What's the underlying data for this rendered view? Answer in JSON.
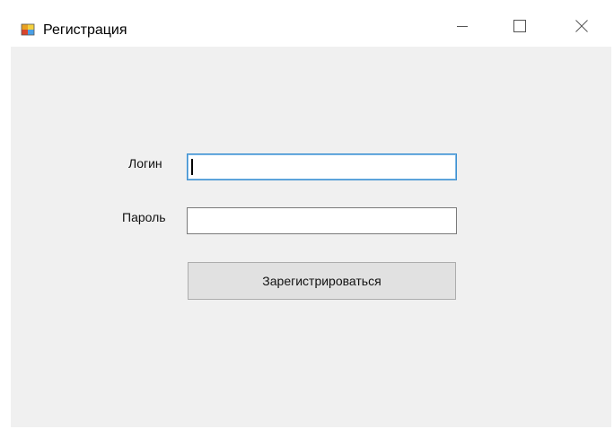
{
  "window": {
    "title": "Регистрация",
    "icon": "windows-form-app-icon",
    "controls": {
      "minimize_icon": "minimize-icon",
      "maximize_icon": "maximize-icon",
      "close_icon": "close-icon"
    }
  },
  "form": {
    "login_label": "Логин",
    "login_value": "",
    "password_label": "Пароль",
    "password_value": "",
    "register_button": "Зарегистрироваться"
  },
  "colors": {
    "client_background": "#f0f0f0",
    "focus_border": "#3c8fd0",
    "button_background": "#e1e1e1"
  }
}
